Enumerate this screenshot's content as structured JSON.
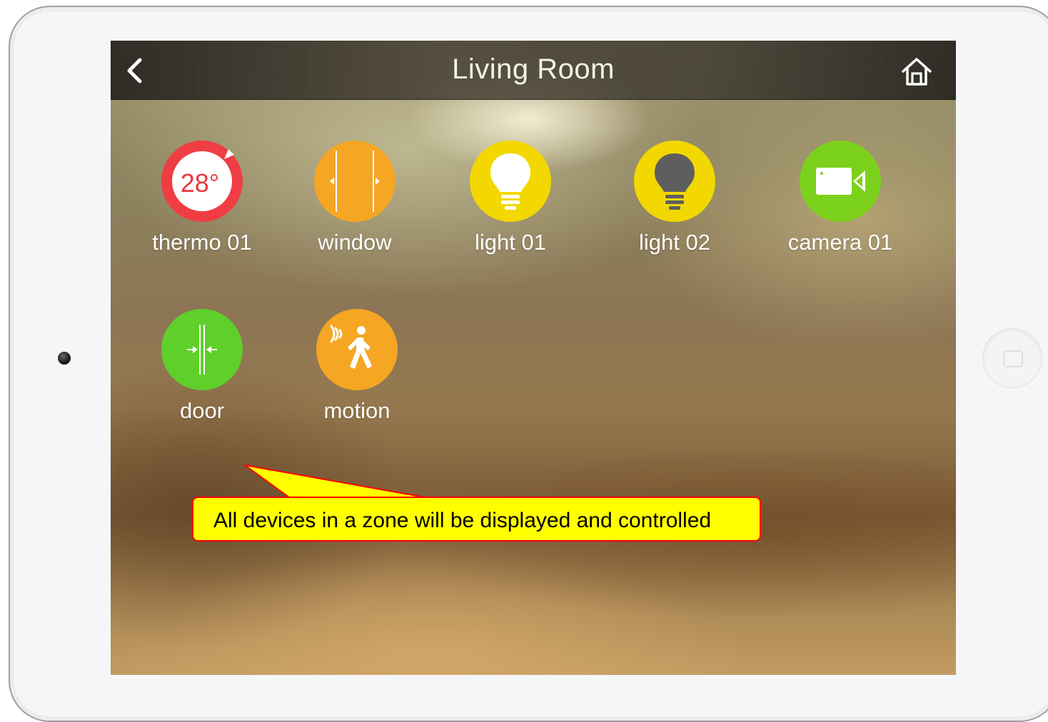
{
  "header": {
    "title": "Living Room",
    "back_icon": "chevron-left-icon",
    "home_icon": "home-icon"
  },
  "devices": [
    {
      "label": "thermo 01",
      "icon": "thermostat-icon",
      "color": "#ef3e43",
      "value": "28°"
    },
    {
      "label": "window",
      "icon": "window-icon",
      "color": "#f5a623"
    },
    {
      "label": "light 01",
      "icon": "lightbulb-on-icon",
      "color": "#f2d800"
    },
    {
      "label": "light 02",
      "icon": "lightbulb-off-icon",
      "color": "#f2d800"
    },
    {
      "label": "camera 01",
      "icon": "camera-icon",
      "color": "#7cd11d"
    },
    {
      "label": "door",
      "icon": "door-icon",
      "color": "#5fcf2a"
    },
    {
      "label": "motion",
      "icon": "motion-sensor-icon",
      "color": "#f5a623"
    }
  ],
  "annotation": {
    "text": "All devices in a zone will be displayed and controlled",
    "fill": "#ffff00",
    "border": "#ff0000"
  }
}
